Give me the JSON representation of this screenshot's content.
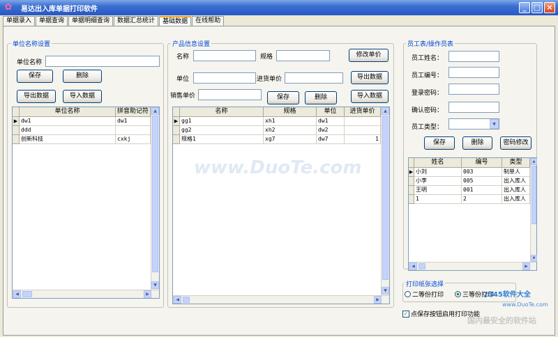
{
  "window": {
    "title": "易达出入库单据打印软件",
    "app_icon": "flower-icon"
  },
  "tabs": [
    {
      "label": "单据录入"
    },
    {
      "label": "单据查询"
    },
    {
      "label": "单据明细查询"
    },
    {
      "label": "数据汇总统计"
    },
    {
      "label": "基础数据",
      "active": true
    },
    {
      "label": "在线帮助"
    }
  ],
  "unit_panel": {
    "legend": "单位名称设置",
    "name_label": "单位名称",
    "name_value": "",
    "save": "保存",
    "delete": "删除",
    "export": "导出数据",
    "import": "导入数据",
    "columns": [
      "单位名称",
      "拼音助记符"
    ],
    "rows": [
      [
        "dw1",
        "dw1"
      ],
      [
        "ddd",
        ""
      ],
      [
        "创新科技",
        "cxkj"
      ]
    ]
  },
  "product_panel": {
    "legend": "产品信息设置",
    "name_label": "名称",
    "spec_label": "规格",
    "unit_label": "单位",
    "purchase_label": "进货单价",
    "sale_label": "销售单价",
    "modify_price": "修改单价",
    "export": "导出数据",
    "save": "保存",
    "delete": "删除",
    "import": "导入数据",
    "columns": [
      "名称",
      "规格",
      "单位",
      "进货单价"
    ],
    "rows": [
      [
        "gg1",
        "xh1",
        "dw1",
        ""
      ],
      [
        "gg2",
        "xh2",
        "dw2",
        ""
      ],
      [
        "规格1",
        "xg7",
        "dw7",
        "1"
      ]
    ]
  },
  "staff_panel": {
    "legend": "员工表/操作员表",
    "name_label": "员工姓名：",
    "id_label": "员工编号：",
    "pwd_label": "登录密码：",
    "confirm_label": "确认密码：",
    "type_label": "员工类型：",
    "save": "保存",
    "delete": "删除",
    "change_pwd": "密码修改",
    "columns": [
      "姓名",
      "编号",
      "类型"
    ],
    "rows": [
      [
        "小刘",
        "003",
        "制单人"
      ],
      [
        "小李",
        "005",
        "出入库人"
      ],
      [
        "王明",
        "001",
        "出入库人"
      ],
      [
        "1",
        "2",
        "出入库人"
      ]
    ]
  },
  "print_panel": {
    "legend": "打印纸张选择",
    "option1": "二等份打印",
    "option2": "三等份打印",
    "selected": "三等份打印",
    "checkbox_label": "点保存按钮启用打印功能",
    "checkbox_checked": true
  },
  "watermarks": {
    "main": "www.DuoTe.com",
    "corner1": "2345软件大全",
    "corner2": "www.DuoTe.com",
    "corner3": "国内最安全的软件站"
  },
  "colors": {
    "titlebar": "#2757c4",
    "legend": "#0046d5",
    "active_tab_accent": "#f5a623"
  }
}
